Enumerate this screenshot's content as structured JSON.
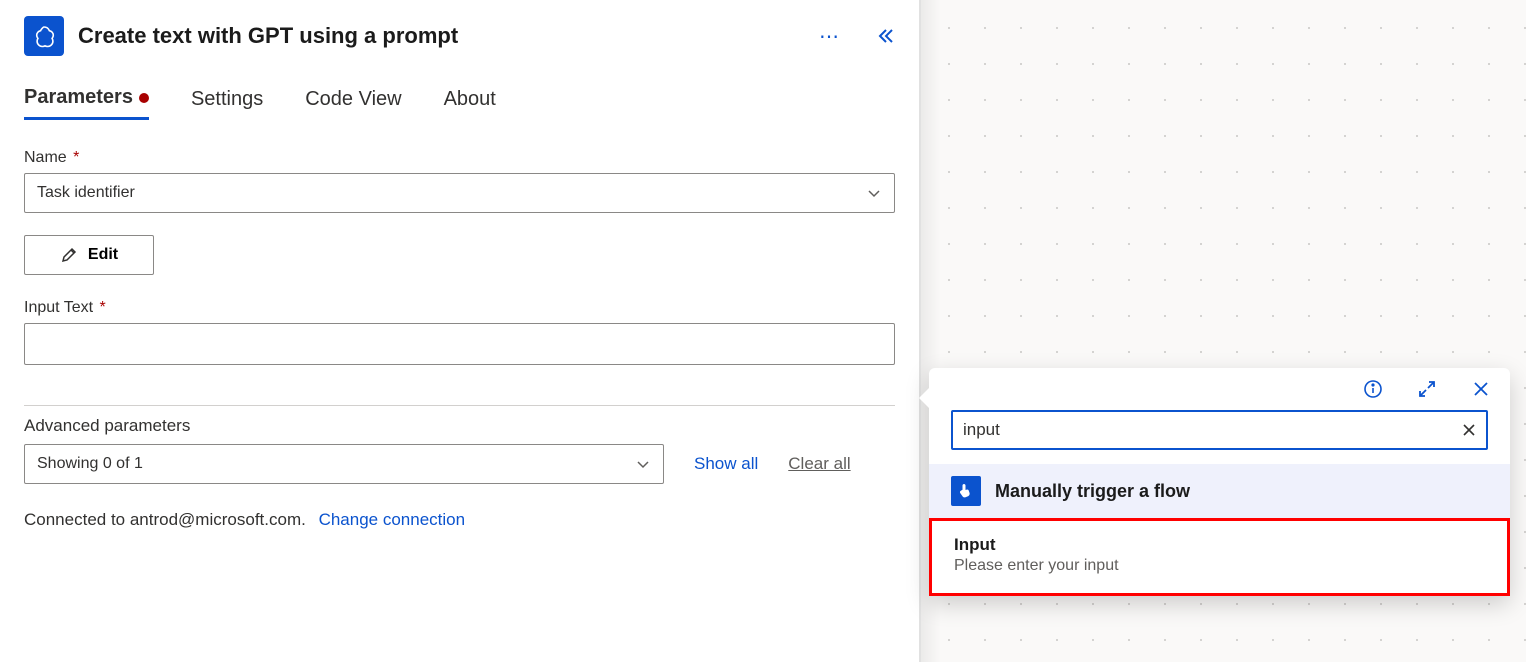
{
  "header": {
    "title": "Create text with GPT using a prompt"
  },
  "tabs": [
    {
      "label": "Parameters",
      "active": true,
      "hasIndicator": true
    },
    {
      "label": "Settings"
    },
    {
      "label": "Code View"
    },
    {
      "label": "About"
    }
  ],
  "fields": {
    "name": {
      "label": "Name",
      "required": "*",
      "value": "Task identifier"
    },
    "edit": {
      "label": "Edit"
    },
    "inputText": {
      "label": "Input Text",
      "required": "*",
      "value": ""
    }
  },
  "advanced": {
    "label": "Advanced parameters",
    "value": "Showing 0 of 1",
    "showAll": "Show all",
    "clearAll": "Clear all"
  },
  "connection": {
    "text": "Connected to antrod@microsoft.com.",
    "link": "Change connection"
  },
  "dynamicContent": {
    "search": {
      "value": "input"
    },
    "group": {
      "title": "Manually trigger a flow"
    },
    "result": {
      "title": "Input",
      "desc": "Please enter your input"
    }
  }
}
